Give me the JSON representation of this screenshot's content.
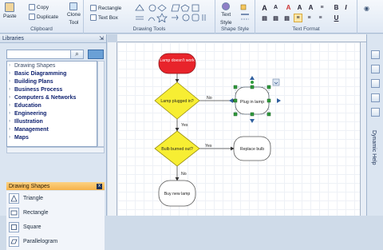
{
  "ribbon": {
    "clipboard": {
      "paste": "Paste",
      "copy": "Copy",
      "duplicate": "Duplicate",
      "label": "Clipboard"
    },
    "tools": {
      "clone": "Clone",
      "clone2": "Tool",
      "rectangle": "Rectangle",
      "textbox": "Text Box",
      "label": "Drawing Tools"
    },
    "shape_style": {
      "line1": "Text",
      "line2": "Style",
      "label": "Shape Style"
    },
    "text_format": {
      "label": "Text Format",
      "bold": "B",
      "italic": "I",
      "underline": "U"
    }
  },
  "libraries": {
    "title": "Libraries",
    "pin": "⇲",
    "items": [
      "Drawing Shapes",
      "Basic Diagramming",
      "Building Plans",
      "Business Process",
      "Computers & Networks",
      "Education",
      "Engineering",
      "Illustration",
      "Management",
      "Maps"
    ]
  },
  "stencil": {
    "title": "Drawing Shapes",
    "close": "x",
    "items": [
      "Triangle",
      "Rectangle",
      "Square",
      "Parallelogram"
    ]
  },
  "flowchart": {
    "start": "Lamp doesn't work",
    "decision1": "Lamp plugged in?",
    "yes1": "Yes",
    "no1": "No",
    "process1": "Plug in lamp",
    "decision2": "Bulb burned out?",
    "yes2": "Yes",
    "no2": "No",
    "process2": "Replace bulb",
    "process3": "Buy new lamp"
  },
  "right_panel": {
    "label": "Dynamic Help"
  },
  "colors": {
    "accent": "#f6b24a",
    "start_fill": "#e8242b",
    "decision_fill": "#f7ee33",
    "selection": "#2f9b3c"
  }
}
